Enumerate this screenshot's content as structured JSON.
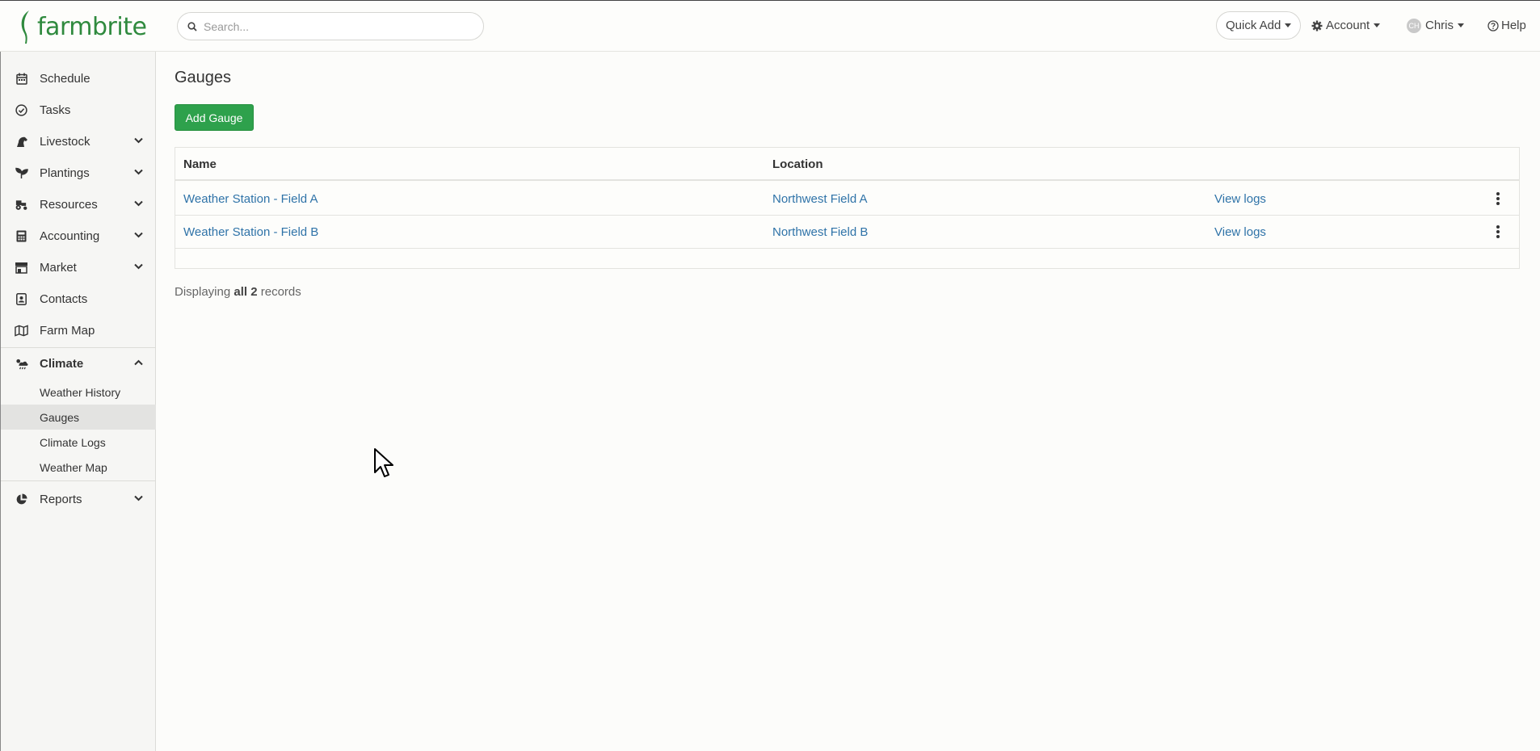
{
  "brand": {
    "name": "farmbrite",
    "logo_icon": "leaf-icon",
    "color": "#2f8a3e"
  },
  "search": {
    "placeholder": "Search..."
  },
  "header": {
    "quick_add": "Quick Add",
    "account": "Account",
    "user": "Chris",
    "user_initials": "CH",
    "help": "Help"
  },
  "sidebar": {
    "items": [
      {
        "label": "Schedule",
        "icon": "calendar-icon"
      },
      {
        "label": "Tasks",
        "icon": "check-circle-icon"
      },
      {
        "label": "Livestock",
        "icon": "horse-icon",
        "expandable": true
      },
      {
        "label": "Plantings",
        "icon": "seedling-icon",
        "expandable": true
      },
      {
        "label": "Resources",
        "icon": "tractor-icon",
        "expandable": true
      },
      {
        "label": "Accounting",
        "icon": "calculator-icon",
        "expandable": true
      },
      {
        "label": "Market",
        "icon": "store-icon",
        "expandable": true
      },
      {
        "label": "Contacts",
        "icon": "address-book-icon"
      },
      {
        "label": "Farm Map",
        "icon": "map-icon"
      }
    ],
    "climate": {
      "label": "Climate",
      "icon": "cloud-sun-rain-icon",
      "expanded": true,
      "children": [
        "Weather History",
        "Gauges",
        "Climate Logs",
        "Weather Map"
      ],
      "active": "Gauges"
    },
    "reports": {
      "label": "Reports",
      "icon": "chart-pie-icon"
    }
  },
  "main": {
    "title": "Gauges",
    "add_button": "Add Gauge",
    "table": {
      "columns": [
        "Name",
        "Location"
      ],
      "rows": [
        {
          "name": "Weather Station - Field A",
          "location": "Northwest Field A",
          "action": "View logs"
        },
        {
          "name": "Weather Station - Field B",
          "location": "Northwest Field B",
          "action": "View logs"
        }
      ]
    },
    "records": {
      "prefix": "Displaying",
      "all": "all 2",
      "suffix": "records"
    }
  },
  "colors": {
    "accent_green": "#2ea14c",
    "link": "#2f73a8"
  }
}
